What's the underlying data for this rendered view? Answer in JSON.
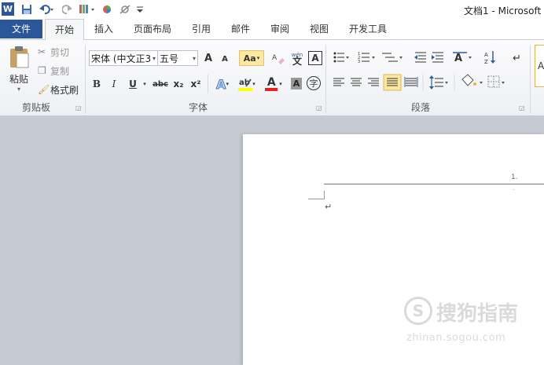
{
  "window": {
    "title": "文档1 - Microsoft"
  },
  "qat": {
    "word_icon": "W",
    "save_icon": "save-icon",
    "undo_icon": "undo-icon",
    "redo_icon": "redo-icon"
  },
  "tabs": [
    {
      "label": "文件"
    },
    {
      "label": "开始"
    },
    {
      "label": "插入"
    },
    {
      "label": "页面布局"
    },
    {
      "label": "引用"
    },
    {
      "label": "邮件"
    },
    {
      "label": "审阅"
    },
    {
      "label": "视图"
    },
    {
      "label": "开发工具"
    }
  ],
  "clipboard": {
    "paste_label": "粘贴",
    "cut_label": "剪切",
    "copy_label": "复制",
    "format_painter_label": "格式刷",
    "group_label": "剪贴板"
  },
  "font": {
    "font_name": "宋体 (中文正3",
    "font_size": "五号",
    "grow_label": "A",
    "shrink_label": "A",
    "case_label": "Aa",
    "bold": "B",
    "italic": "I",
    "underline": "U",
    "strike": "abc",
    "subscript": "x₂",
    "superscript": "x²",
    "text_effect": "A",
    "font_color": "A",
    "char_shading": "A",
    "enclose": "字",
    "phonetic": "wén",
    "border_char": "A",
    "group_label": "字体"
  },
  "paragraph": {
    "group_label": "段落"
  },
  "document": {
    "header_number": "1.",
    "header_mark": ".",
    "paragraph_mark": "↵"
  },
  "watermark": {
    "brand": "搜狗指南",
    "url": "zhinan.sogou.com"
  }
}
